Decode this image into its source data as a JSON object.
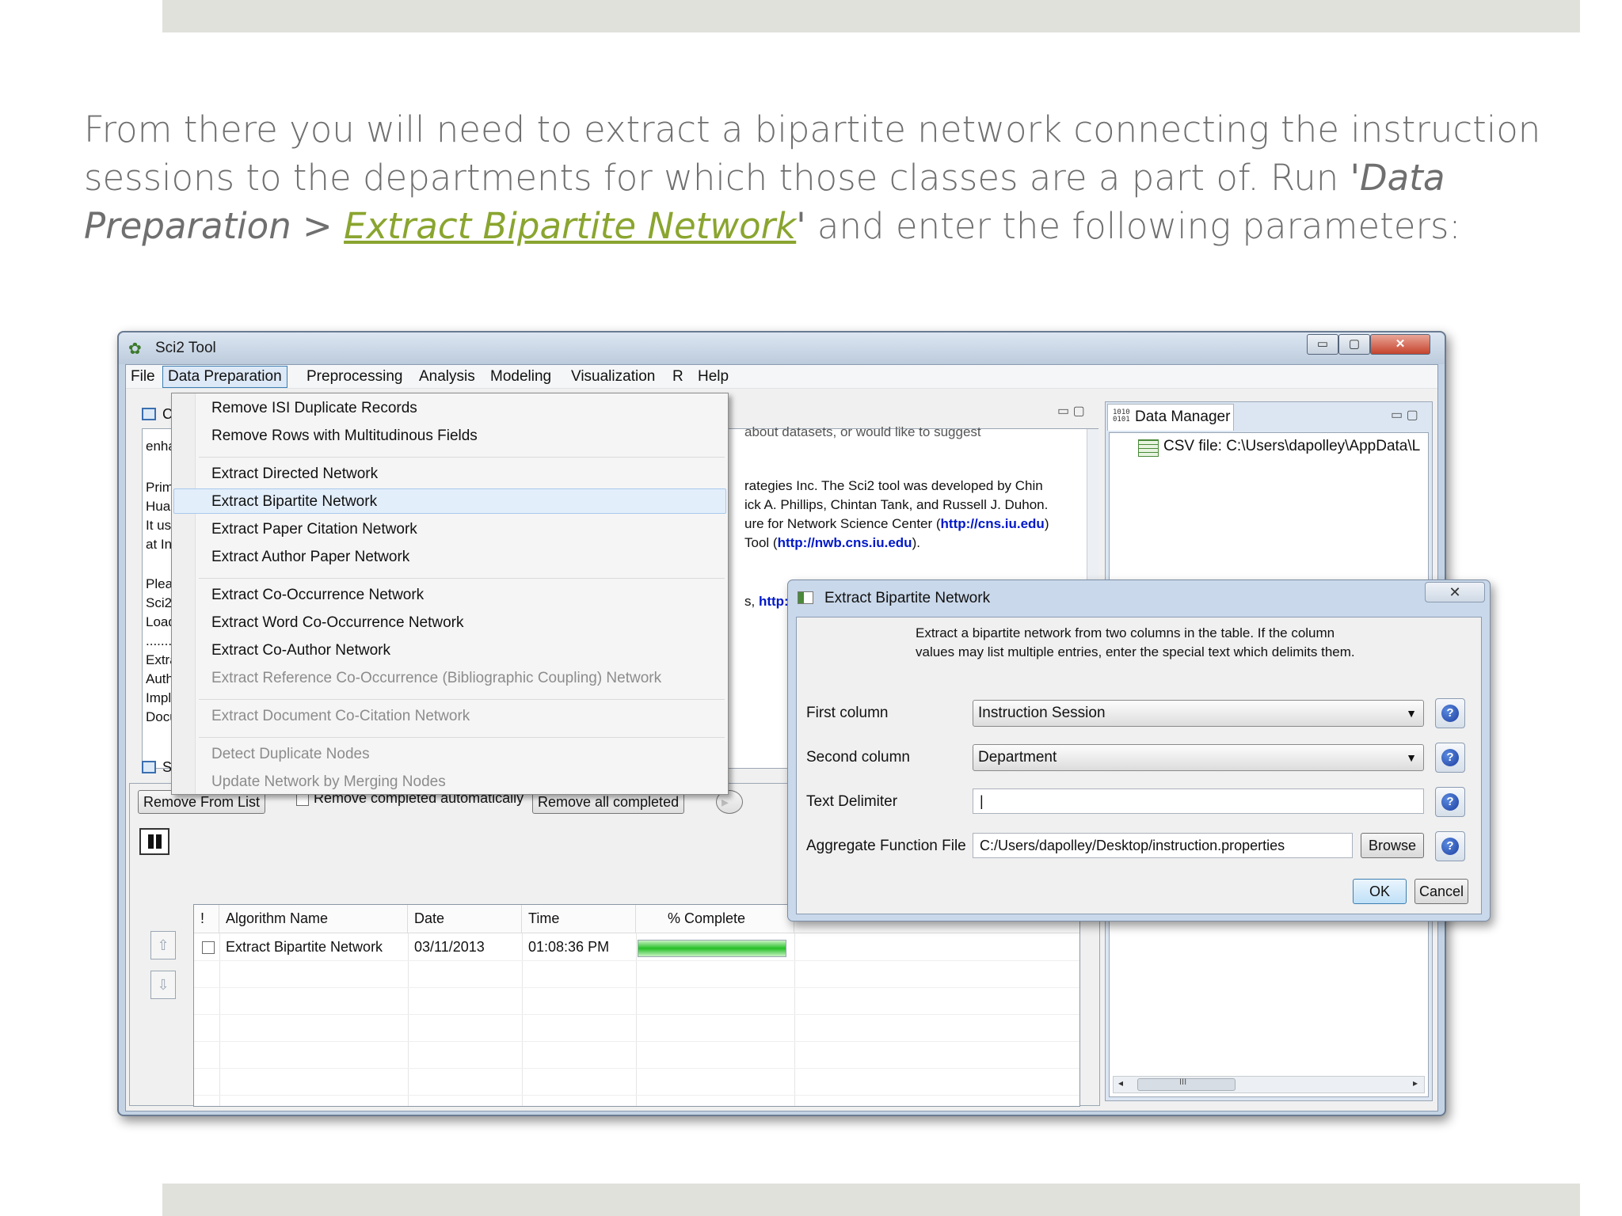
{
  "slide": {
    "line1": "From there you will need to extract a bipartite network connecting the instruction",
    "line2_a": "sessions to the departments for which those classes are a part of. Run ",
    "line2_b": "'Data",
    "line3_a": "Preparation > ",
    "line3_link": "Extract Bipartite Network",
    "line3_b": "'",
    "line3_c": " and enter the following parameters:"
  },
  "window": {
    "title": "Sci2 Tool",
    "controls": {
      "minimize": "▭",
      "maximize": "▢",
      "close": "✕"
    }
  },
  "menubar": [
    "File",
    "Data Preparation",
    "Preprocessing",
    "Analysis",
    "Modeling",
    "Visualization",
    "R",
    "Help"
  ],
  "dropdown": {
    "items": [
      {
        "label": "Remove ISI Duplicate Records",
        "enabled": true
      },
      {
        "label": "Remove Rows with Multitudinous Fields",
        "enabled": true
      },
      {
        "label": "Extract Directed Network",
        "enabled": true
      },
      {
        "label": "Extract Bipartite Network",
        "enabled": true,
        "highlighted": true
      },
      {
        "label": "Extract Paper Citation Network",
        "enabled": true
      },
      {
        "label": "Extract Author Paper Network",
        "enabled": true
      },
      {
        "label": "Extract Co-Occurrence Network",
        "enabled": true
      },
      {
        "label": "Extract Word Co-Occurrence Network",
        "enabled": true
      },
      {
        "label": "Extract Co-Author Network",
        "enabled": true
      },
      {
        "label": "Extract Reference Co-Occurrence (Bibliographic Coupling) Network",
        "enabled": false
      },
      {
        "label": "Extract Document Co-Citation Network",
        "enabled": false
      },
      {
        "label": "Detect Duplicate Nodes",
        "enabled": false
      },
      {
        "label": "Update Network by Merging Nodes",
        "enabled": false
      }
    ]
  },
  "console": {
    "tab_label": "C",
    "left_fragments": [
      "enha",
      "Prim",
      "Hua",
      "It us",
      "at In",
      "Plea",
      "Sci2",
      "Load",
      "........",
      "Extra",
      "Auth",
      "Impl",
      "Docu"
    ],
    "right_lines": {
      "r0": "about datasets, or would like to suggest",
      "r1": "rategies Inc. The Sci2 tool was developed by Chin",
      "r2": "ick A. Phillips, Chintan Tank, and Russell J. Duhon.",
      "r3_a": "ure for Network Science Center (",
      "r3_url": "http://cns.iu.edu",
      "r3_b": ")",
      "r4_a": " Tool (",
      "r4_url": "http://nwb.cns.iu.edu",
      "r4_b": ").",
      "r5_a": "s, ",
      "r5_url": "http:/"
    }
  },
  "data_manager": {
    "tab_label": "Data Manager",
    "tab_icon": "1010\n0101",
    "file": "CSV file: C:\\Users\\dapolley\\AppData\\L",
    "scroll_grip": "III",
    "scroll_left": "◂",
    "scroll_right": "▸"
  },
  "scheduler": {
    "tab_label": "S",
    "remove_from_list": "Remove From List",
    "remove_auto_label": "Remove completed automatically",
    "remove_all": "Remove all completed",
    "up_arrow": "⇧",
    "down_arrow": "⇩",
    "columns": [
      "!",
      "Algorithm Name",
      "Date",
      "Time",
      "% Complete"
    ],
    "rows": [
      {
        "name": "Extract Bipartite Network",
        "date": "03/11/2013",
        "time": "01:08:36 PM",
        "progress": 1.0
      }
    ]
  },
  "dialog": {
    "title": "Extract Bipartite Network",
    "close": "✕",
    "description": "Extract a bipartite network from two columns in the table.  If the column values may list multiple entries, enter the special text which delimits them.",
    "first_column_label": "First column",
    "first_column_value": "Instruction Session",
    "second_column_label": "Second column",
    "second_column_value": "Department",
    "text_delimiter_label": "Text Delimiter",
    "text_delimiter_value": "|",
    "aggregate_label": "Aggregate Function File",
    "aggregate_value": "C:/Users/dapolley/Desktop/instruction.properties",
    "browse": "Browse",
    "ok": "OK",
    "cancel": "Cancel",
    "help_glyph": "?",
    "combo_arrow": "▼"
  }
}
